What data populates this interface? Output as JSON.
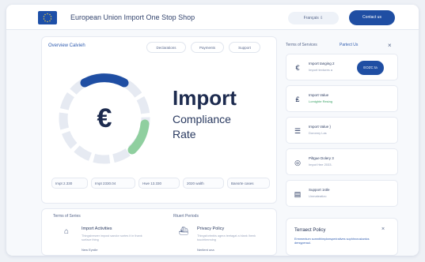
{
  "header": {
    "app_title": "European Union Import One Stop Shop",
    "language_label": "Français ⇩",
    "contact_label": "Contact us"
  },
  "main": {
    "tabs_left": "Overview  Calvieh",
    "pills": [
      "Declarations",
      "Payments",
      "Support"
    ],
    "title": "Import",
    "subtitle_line1": "Compliance",
    "subtitle_line2": "Rate",
    "euro_symbol": "€",
    "stats": [
      {
        "value": "Impt 2.330"
      },
      {
        "value": "Impt 2330.04"
      },
      {
        "value": "Hwe 13.330"
      },
      {
        "value": "2020 walth"
      },
      {
        "value": "Bansrte cases"
      }
    ]
  },
  "side": {
    "head_left": "Terms of Services",
    "head_right": "Partect Us",
    "cards": [
      {
        "icon": "€",
        "title": "Import tanging 2",
        "sub": "Import textures a",
        "button": "EOZC ta",
        "sub_status": "muted"
      },
      {
        "icon": "₤",
        "title": "Import Value",
        "sub": "Lomighte Resing",
        "button": "",
        "sub_status": "green"
      },
      {
        "icon": "☰",
        "title": "Import Value }",
        "sub": "Doronny Las",
        "button": "",
        "sub_status": "muted"
      },
      {
        "icon": "◎",
        "title": "Piltgue Dolery 3",
        "sub": "Impot Hee 2033.",
        "button": "",
        "sub_status": "muted"
      },
      {
        "icon": "▤",
        "title": "Support 1stle",
        "sub": "Unmateatizo",
        "button": "",
        "sub_status": "muted"
      }
    ]
  },
  "bottom": {
    "left_head": "Terms of Series",
    "right_head": "Rtuert Periods",
    "items": [
      {
        "title": "Import Activities",
        "desc": "Thingsbrewer impost sandor sortes it in thank surface thing",
        "meta": "New Eyrdle"
      },
      {
        "title": "Privacy Policy",
        "desc": "Thingsfortmbis agera teetagat a blank Ihenk touchtimmdng",
        "meta": "Nerilent ona"
      }
    ]
  },
  "policy": {
    "title": "Terraect Policy",
    "desc": "Ermmentum somnthimplwrsperiratives sophhrcrustantcs dersyperaul."
  },
  "colors": {
    "brand": "#1f4ea3",
    "ring_accent_green": "#8fcf9f",
    "ring_accent_blue": "#1f4ea3"
  }
}
